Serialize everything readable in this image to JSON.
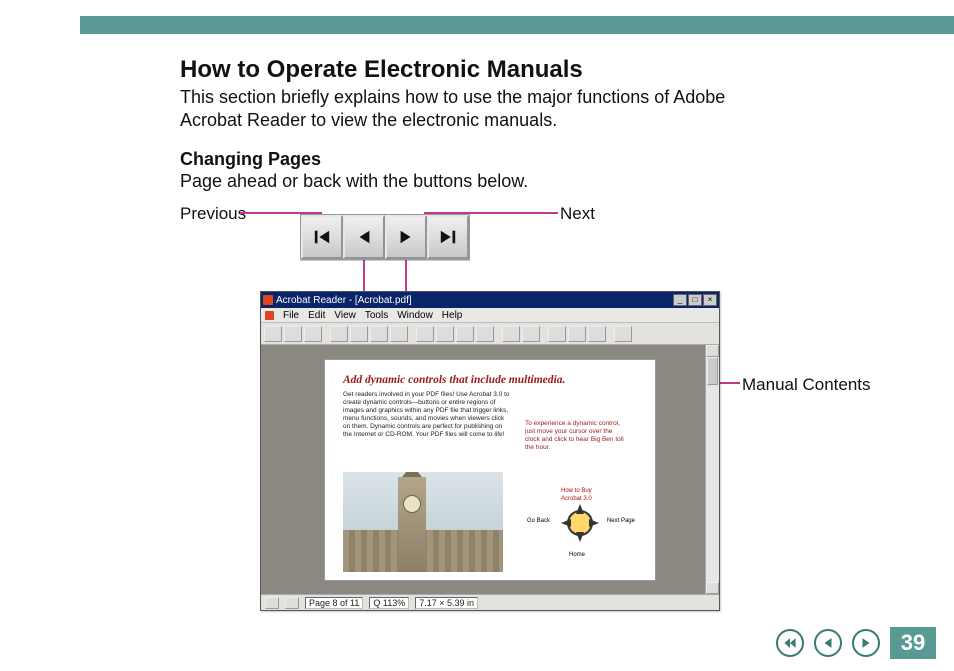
{
  "header_bar": {},
  "heading": "How to Operate Electronic Manuals",
  "intro": "This section briefly explains how to use the major functions of Adobe Acrobat Reader to view the electronic manuals.",
  "section": {
    "title": "Changing Pages",
    "desc": "Page ahead or back with the buttons below."
  },
  "labels": {
    "previous": "Previous",
    "next": "Next",
    "manual_contents": "Manual Contents"
  },
  "nav_buttons": [
    {
      "name": "first-page-button"
    },
    {
      "name": "previous-page-button"
    },
    {
      "name": "next-page-button"
    },
    {
      "name": "last-page-button"
    }
  ],
  "acrobat_window": {
    "title": "Acrobat Reader - [Acrobat.pdf]",
    "menu": [
      "File",
      "Edit",
      "View",
      "Tools",
      "Window",
      "Help"
    ],
    "statusbar": {
      "page": "Page 8 of 11",
      "zoom": "Q  113%",
      "size": "7.17 × 5.39 in"
    },
    "page": {
      "title": "Add dynamic controls that include multimedia.",
      "body": "Get readers involved in your PDF files! Use Acrobat 3.0 to create dynamic controls—buttons or entire regions of images and graphics within any PDF file that trigger links, menu functions, sounds, and movies when viewers click on them. Dynamic controls are perfect for publishing on the Internet or CD-ROM. Your PDF files will come to life!",
      "body_r": "To experience a dynamic control, just move your cursor over the clock and click to hear Big Ben toll the hour.",
      "compass": {
        "top1": "How to Buy",
        "top2": "Acrobat 3.0",
        "left": "Go Back",
        "right": "Next Page",
        "bottom": "Home"
      }
    }
  },
  "footer": {
    "page_number": "39"
  }
}
